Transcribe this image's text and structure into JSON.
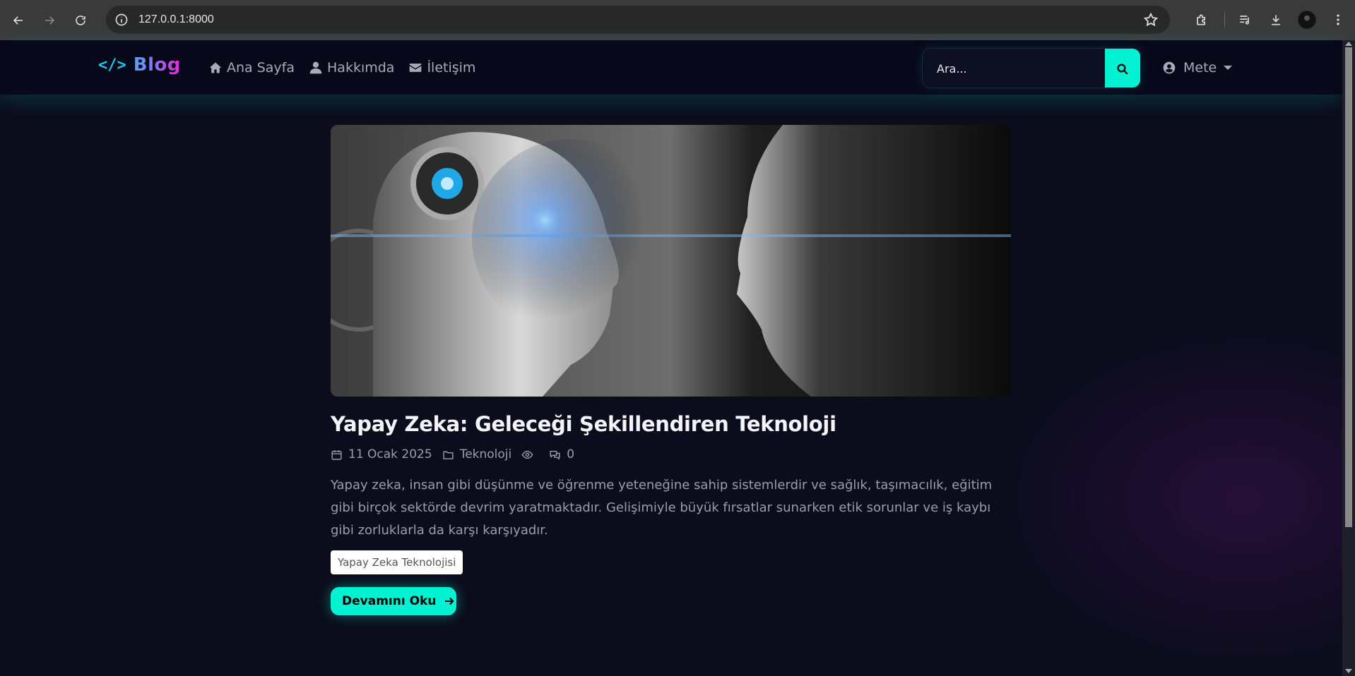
{
  "browser": {
    "url": "127.0.0.1:8000"
  },
  "navbar": {
    "brand_code": "</>",
    "brand_name": "Blog",
    "links": [
      {
        "label": "Ana Sayfa",
        "icon": "home-icon"
      },
      {
        "label": "Hakkımda",
        "icon": "user-icon"
      },
      {
        "label": "İletişim",
        "icon": "envelope-icon"
      }
    ],
    "search": {
      "placeholder": "Ara...",
      "value": ""
    },
    "user": {
      "name": "Mete",
      "icon": "user-circle-icon"
    }
  },
  "article": {
    "title": "Yapay Zeka: Geleceği Şekillendiren Teknoloji",
    "date": "11 Ocak 2025",
    "category": "Teknoloji",
    "views": "",
    "comments": "0",
    "excerpt": "Yapay zeka, insan gibi düşünme ve öğrenme yeteneğine sahip sistemlerdir ve sağlık, taşımacılık, eğitim gibi birçok sektörde devrim yaratmaktadır. Gelişimiyle büyük fırsatlar sunarken etik sorunlar ve iş kaybı gibi zorluklarla da karşı karşıyadır.",
    "tag": "Yapay Zeka Teknolojisi",
    "read_more": "Devamını Oku"
  },
  "colors": {
    "accent": "#00f2d2",
    "brand_gradient_start": "#4aa8ff",
    "brand_gradient_end": "#e02bd5",
    "background": "#0b0c1c"
  }
}
